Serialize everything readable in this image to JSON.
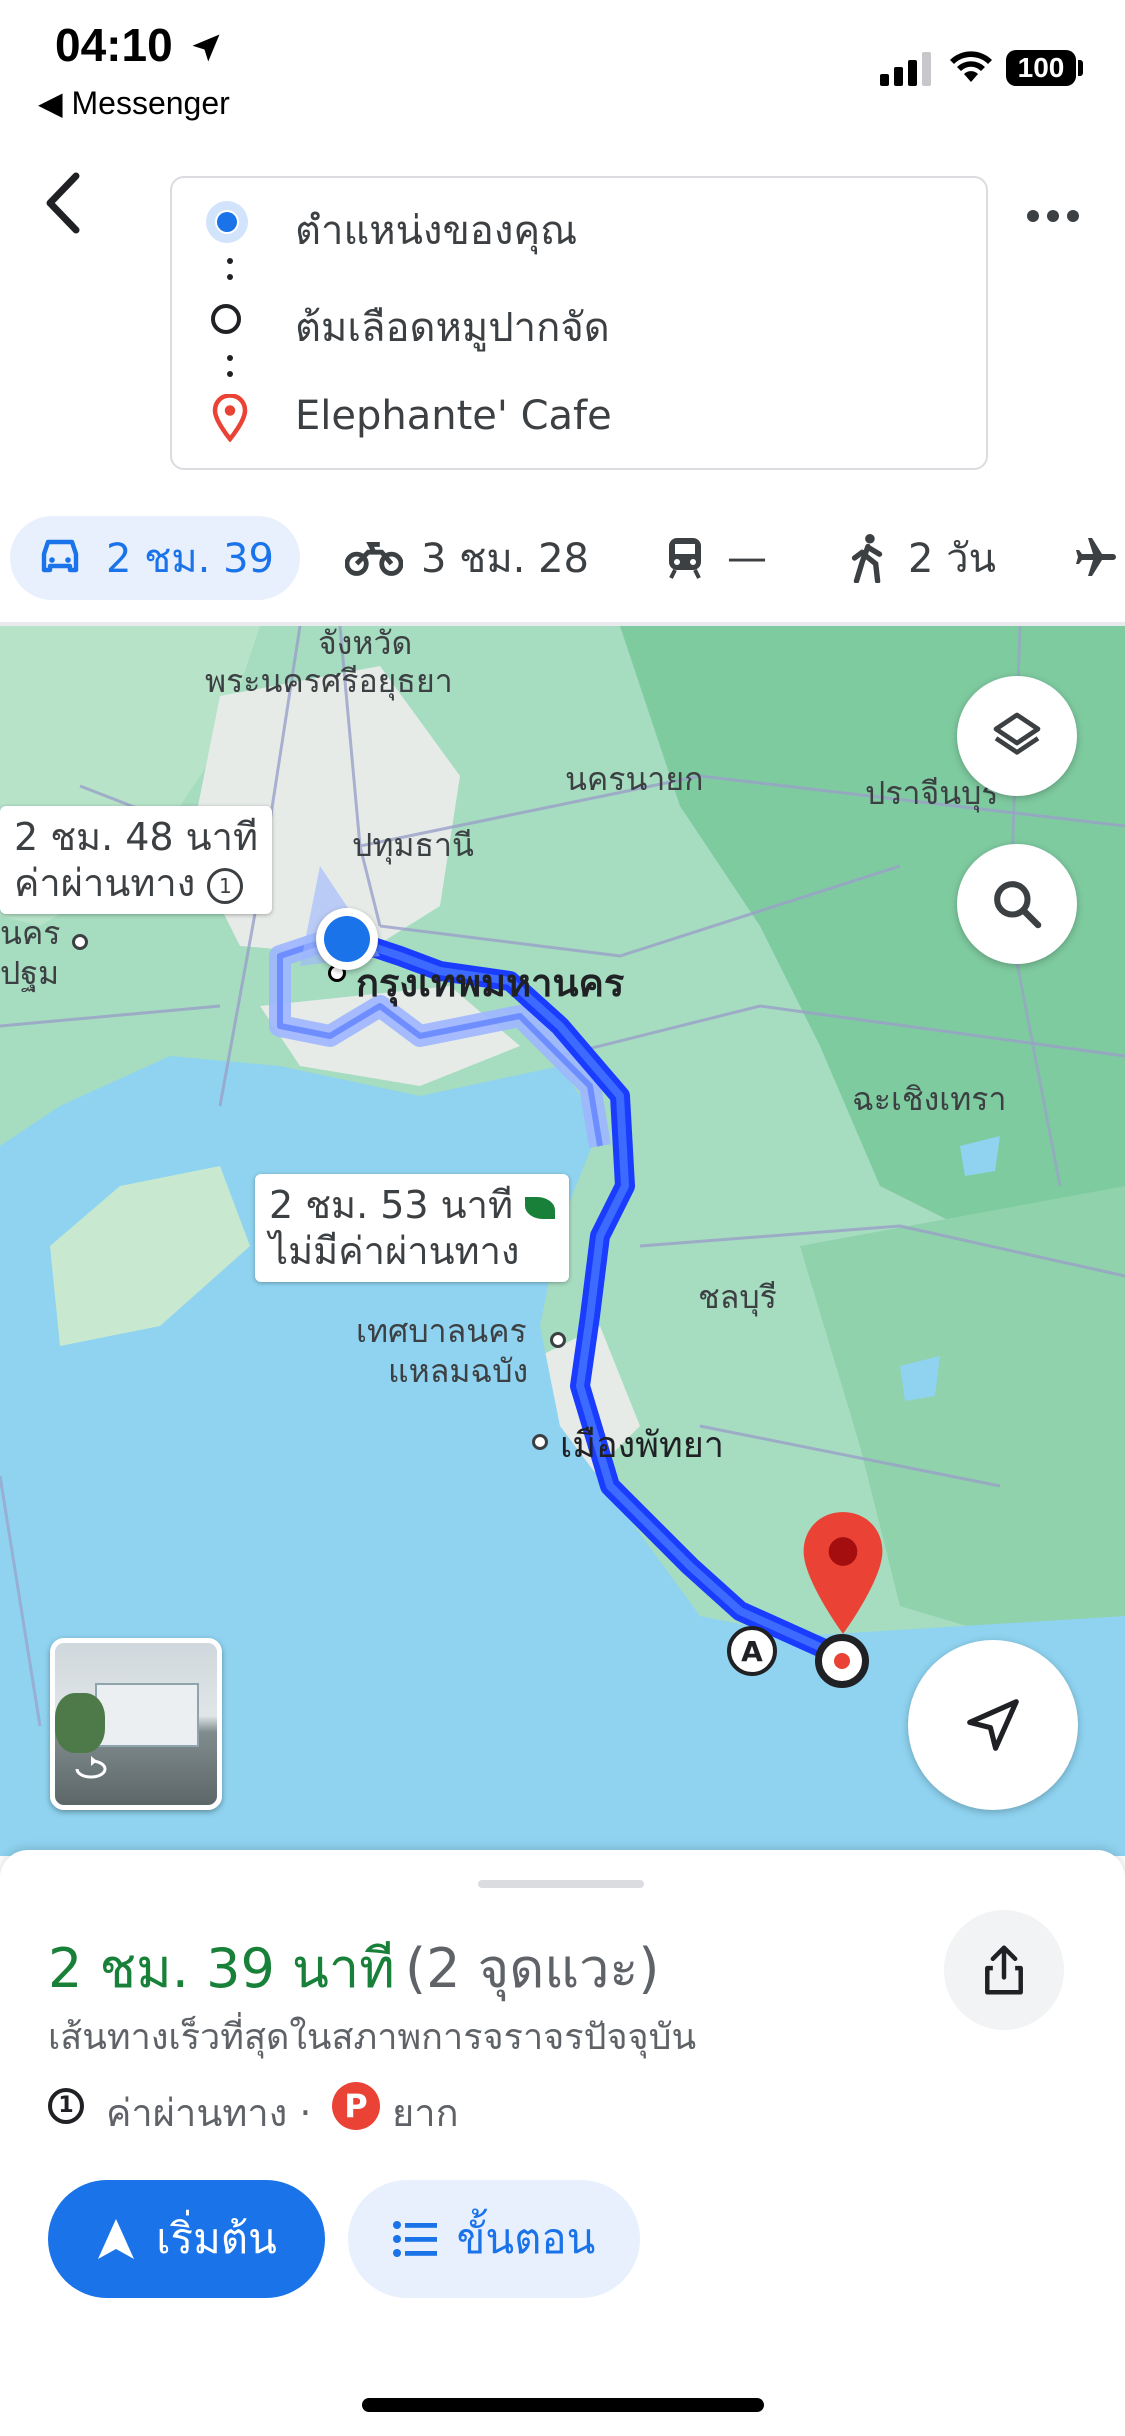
{
  "status": {
    "time": "04:10",
    "back_app": "◀ Messenger",
    "battery": "100"
  },
  "header": {
    "stops": [
      "ตำแหน่งของคุณ",
      "ต้มเลือดหมูปากจัด",
      "Elephante' Cafe"
    ]
  },
  "modes": {
    "drive": "2 ชม. 39",
    "motorcycle": "3 ชม. 28",
    "transit": "—",
    "walk": "2 วัน"
  },
  "map": {
    "labels": {
      "ayutthaya_top": "จังหวัด",
      "ayutthaya": "พระนครศรีอยุธยา",
      "nakhon_nayok": "นครนายก",
      "prachinburi": "ปราจีนบุรี",
      "pathum_thani": "ปทุมธานี",
      "bangkok": "กรุงเทพมหานคร",
      "chachoengsao": "ฉะเชิงเทรา",
      "chonburi": "ชลบุรี",
      "laem_chabang_1": "เทศบาลนคร",
      "laem_chabang_2": "แหลมฉบัง",
      "pattaya": "เมืองพัทยา",
      "left_1": "นคร",
      "left_2": "ปฐม",
      "marker_a": "A"
    },
    "callout_alt": {
      "line1": "2 ชม. 48 นาที",
      "line2": "ค่าผ่านทาง"
    },
    "callout_main": {
      "line1": "2 ชม. 53 นาที",
      "line2": "ไม่มีค่าผ่านทาง"
    }
  },
  "sheet": {
    "duration": "2 ชม. 39 นาที",
    "stops_count": "(2 จุดแวะ)",
    "description": "เส้นทางเร็วที่สุดในสภาพการจราจรปัจจุบัน",
    "toll": "ค่าผ่านทาง ·",
    "parking": "ยาก",
    "parking_badge": "P",
    "start_label": "เริ่มต้น",
    "steps_label": "ขั้นตอน"
  },
  "colors": {
    "accent": "#1a73e8",
    "route": "#1a3cff",
    "water": "#8fd3f0",
    "land": "#a6dcc0",
    "duration": "#188038"
  }
}
